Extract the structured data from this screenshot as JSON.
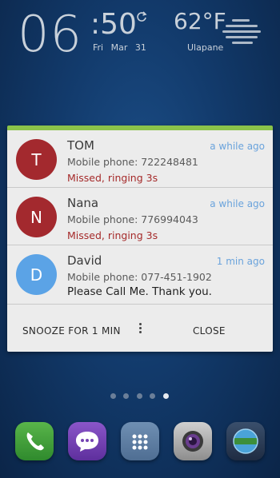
{
  "status_widget": {
    "hour": "06",
    "minute": ":50",
    "day": "Fri",
    "date": "Mar 31",
    "temperature": "62°F",
    "location": "Ulapane"
  },
  "notification": {
    "accent_color": "#8bc34a",
    "items": [
      {
        "initial": "T",
        "name": "TOM",
        "time": "a while ago",
        "phone": "Mobile phone: 722248481",
        "status": "Missed, ringing 3s",
        "avatar_color": "#a3292e"
      },
      {
        "initial": "N",
        "name": "Nana",
        "time": "a while ago",
        "phone": "Mobile phone: 776994043",
        "status": "Missed, ringing 3s",
        "avatar_color": "#a3292e"
      },
      {
        "initial": "D",
        "name": "David",
        "time": "1 min ago",
        "phone": "Mobile phone: 077-451-1902",
        "status": "Please Call Me. Thank you.",
        "avatar_color": "#5ba3e6"
      }
    ],
    "snooze_label": "SNOOZE FOR 1 MIN",
    "close_label": "CLOSE"
  },
  "page_indicator": {
    "count": 5,
    "active_index": 4
  },
  "dock": {
    "apps": [
      {
        "icon": "phone-icon",
        "color": "#3f9e38"
      },
      {
        "icon": "messages-icon",
        "color": "#7443b3"
      },
      {
        "icon": "apps-grid-icon",
        "color": "#5f7fa3"
      },
      {
        "icon": "camera-icon",
        "color": "#a9a9a9"
      },
      {
        "icon": "browser-icon",
        "color": "#2b3b55"
      }
    ]
  }
}
